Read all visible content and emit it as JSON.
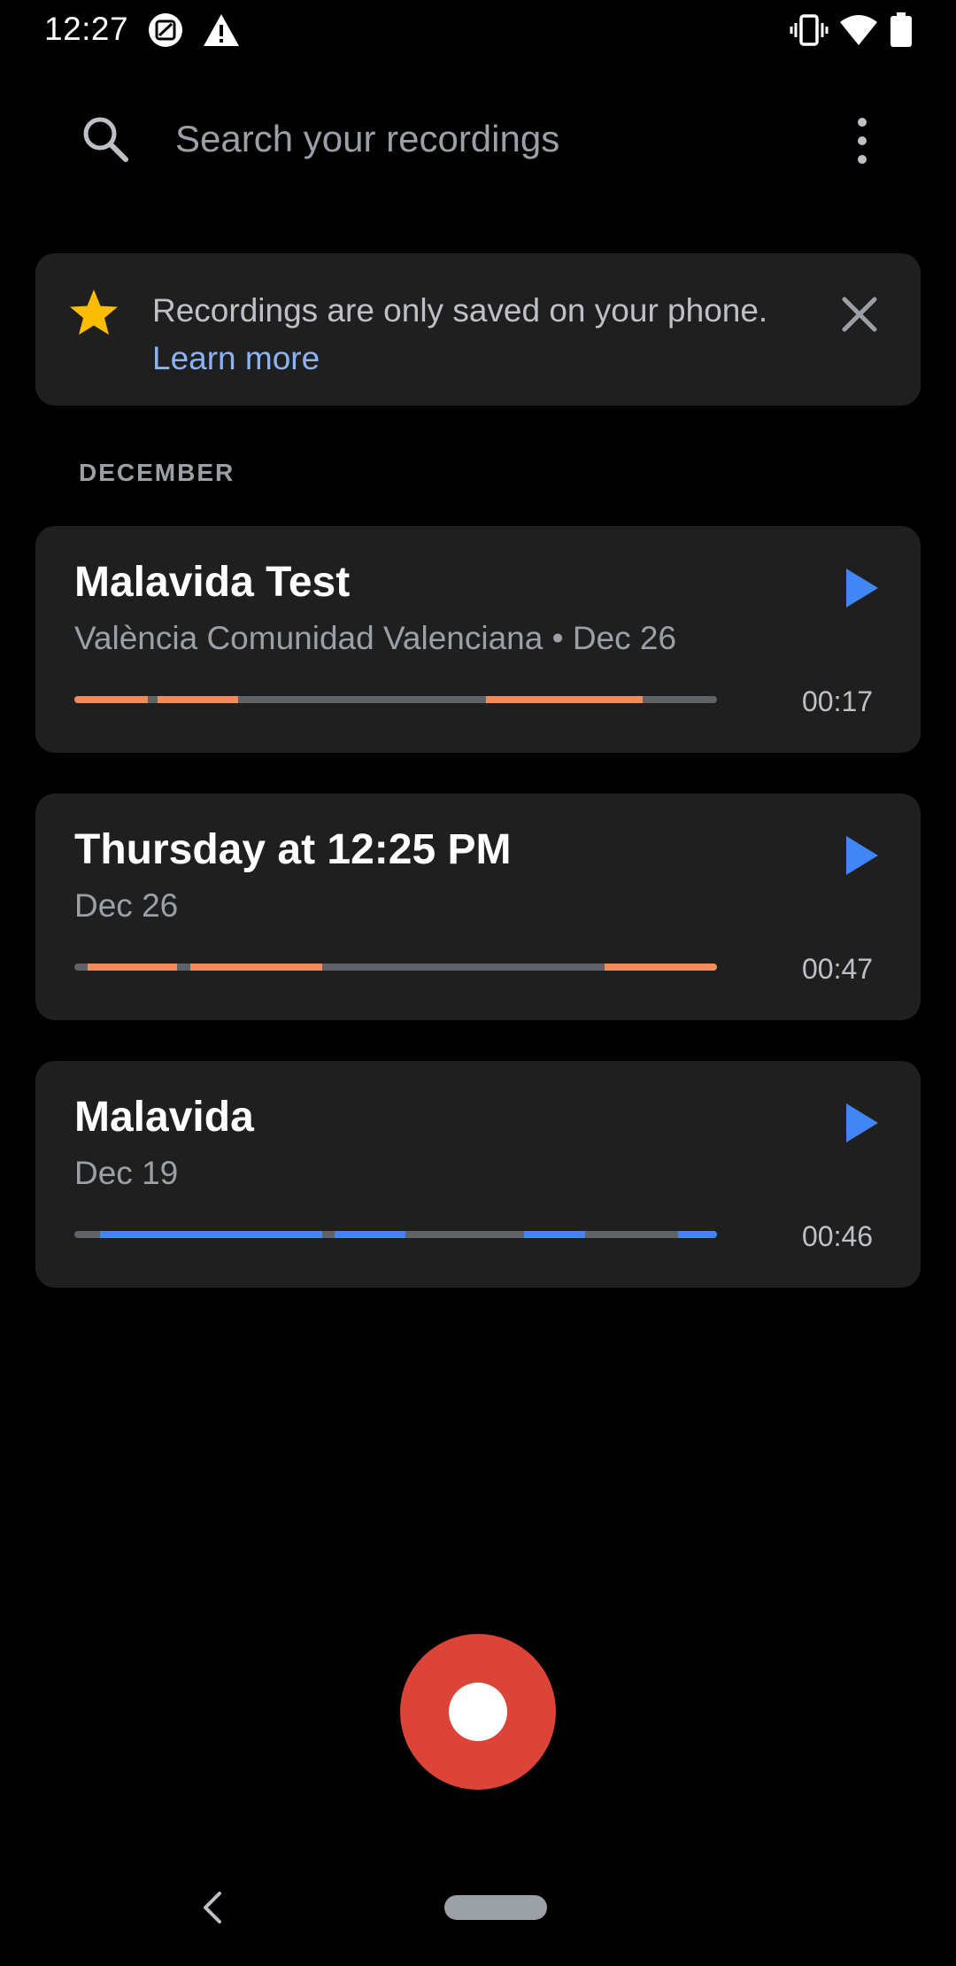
{
  "status_bar": {
    "time": "12:27",
    "left_icons": [
      "image-badge-icon",
      "warning-icon"
    ],
    "right_icons": [
      "vibrate-icon",
      "wifi-icon",
      "battery-icon"
    ]
  },
  "search": {
    "placeholder": "Search your recordings",
    "icon": "search-icon",
    "menu_icon": "more-vert-icon"
  },
  "banner": {
    "icon": "star-icon",
    "message": "Recordings are only saved on your phone.",
    "link": "Learn more",
    "close_icon": "close-icon"
  },
  "section": {
    "heading": "DECEMBER"
  },
  "recordings": [
    {
      "title": "Malavida Test",
      "subtitle": "València Comunidad Valenciana • Dec 26",
      "duration": "00:17",
      "bar_color": "#f28b59",
      "segments": [
        [
          0.0,
          0.115
        ],
        [
          0.13,
          0.255
        ],
        [
          0.64,
          0.885
        ]
      ]
    },
    {
      "title": "Thursday at 12:25 PM",
      "subtitle": "Dec 26",
      "duration": "00:47",
      "bar_color": "#f28b59",
      "segments": [
        [
          0.02,
          0.16
        ],
        [
          0.18,
          0.385
        ],
        [
          0.825,
          1.0
        ]
      ]
    },
    {
      "title": "Malavida",
      "subtitle": "Dec 19",
      "duration": "00:46",
      "bar_color": "#4285f4",
      "segments": [
        [
          0.04,
          0.385
        ],
        [
          0.405,
          0.515
        ],
        [
          0.7,
          0.795
        ],
        [
          0.94,
          1.0
        ]
      ]
    }
  ],
  "colors": {
    "background": "#000000",
    "card": "#1f1f20",
    "accent_blue": "#4285f4",
    "link_blue": "#8ab4f8",
    "record_red": "#db4437",
    "star_yellow": "#fbbc04"
  }
}
